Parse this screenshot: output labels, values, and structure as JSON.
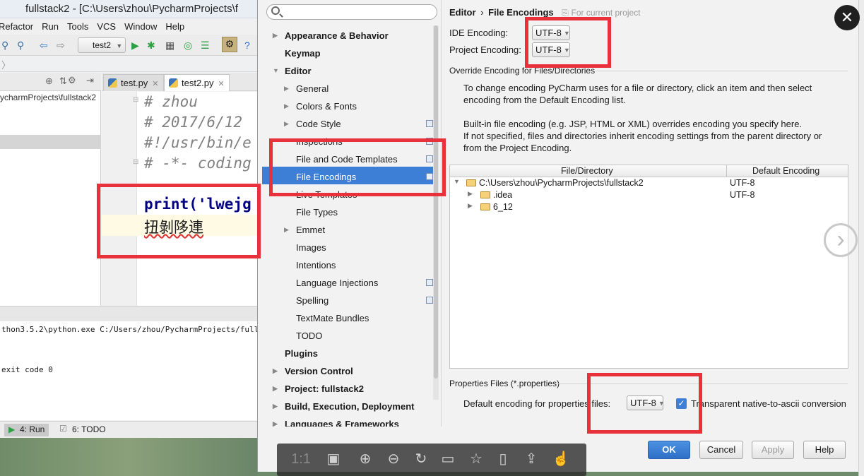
{
  "ide": {
    "title": "fullstack2 - [C:\\Users\\zhou\\PycharmProjects\\f",
    "menu": [
      "Refactor",
      "Run",
      "Tools",
      "VCS",
      "Window",
      "Help"
    ],
    "run_config": "test2",
    "project_path": "ycharmProjects\\fullstack2",
    "tabs": [
      {
        "label": "test.py",
        "active": false
      },
      {
        "label": "test2.py",
        "active": true
      }
    ],
    "code_lines": [
      {
        "text": "# zhou",
        "kind": "comment"
      },
      {
        "text": "# 2017/6/12",
        "kind": "comment"
      },
      {
        "text": "#!/usr/bin/e",
        "kind": "comment"
      },
      {
        "text": "# -*- coding",
        "kind": "comment"
      },
      {
        "text": "print('lwejg",
        "kind": "code"
      },
      {
        "text": "扭剝陊連",
        "kind": "garbled"
      }
    ],
    "console_lines": [
      "thon3.5.2\\python.exe C:/Users/zhou/PycharmProjects/fullstack2",
      "exit code 0"
    ],
    "bottom_tabs": [
      {
        "label": "4: Run",
        "active": true
      },
      {
        "label": "6: TODO",
        "active": false
      }
    ]
  },
  "dialog": {
    "search": {
      "placeholder": ""
    },
    "breadcrumb": {
      "section": "Editor",
      "separator": "›",
      "page": "File Encodings",
      "scope": "For current project"
    },
    "ide_encoding_label": "IDE Encoding:",
    "ide_encoding_value": "UTF-8",
    "project_encoding_label": "Project Encoding:",
    "project_encoding_value": "UTF-8",
    "override_title": "Override Encoding for Files/Directories",
    "help_text_1a": "To change encoding PyCharm uses for a file or directory, click an item and then select",
    "help_text_1b": "encoding from the Default Encoding list.",
    "help_text_2a": "Built-in file encoding (e.g. JSP, HTML or XML) overrides encoding you specify here.",
    "help_text_2b": "If not specified, files and directories inherit encoding settings from the parent directory or",
    "help_text_2c": "from the Project Encoding.",
    "table": {
      "columns": [
        "File/Directory",
        "Default Encoding"
      ],
      "rows": [
        {
          "path": "C:\\Users\\zhou\\PycharmProjects\\fullstack2",
          "encoding": "UTF-8"
        },
        {
          "path": ".idea",
          "encoding": "UTF-8"
        },
        {
          "path": "6_12",
          "encoding": ""
        }
      ]
    },
    "properties_title": "Properties Files (*.properties)",
    "properties_label": "Default encoding for properties files:",
    "properties_value": "UTF-8",
    "transparent_label": "Transparent native-to-ascii conversion",
    "transparent_checked": true,
    "buttons": {
      "ok": "OK",
      "cancel": "Cancel",
      "apply": "Apply",
      "help": "Help"
    }
  },
  "tree": [
    {
      "label": "Appearance & Behavior",
      "bold": true,
      "arrow": "right"
    },
    {
      "label": "Keymap",
      "bold": true,
      "arrow": ""
    },
    {
      "label": "Editor",
      "bold": true,
      "arrow": "down"
    },
    {
      "label": "General",
      "bold": false,
      "arrow": "right"
    },
    {
      "label": "Colors & Fonts",
      "bold": false,
      "arrow": "right"
    },
    {
      "label": "Code Style",
      "bold": false,
      "arrow": "right"
    },
    {
      "label": "Inspections",
      "bold": false,
      "arrow": ""
    },
    {
      "label": "File and Code Templates",
      "bold": false,
      "arrow": ""
    },
    {
      "label": "File Encodings",
      "bold": false,
      "arrow": "",
      "selected": true
    },
    {
      "label": "Live Templates",
      "bold": false,
      "arrow": ""
    },
    {
      "label": "File Types",
      "bold": false,
      "arrow": ""
    },
    {
      "label": "Emmet",
      "bold": false,
      "arrow": "right"
    },
    {
      "label": "Images",
      "bold": false,
      "arrow": ""
    },
    {
      "label": "Intentions",
      "bold": false,
      "arrow": ""
    },
    {
      "label": "Language Injections",
      "bold": false,
      "arrow": ""
    },
    {
      "label": "Spelling",
      "bold": false,
      "arrow": ""
    },
    {
      "label": "TextMate Bundles",
      "bold": false,
      "arrow": ""
    },
    {
      "label": "TODO",
      "bold": false,
      "arrow": ""
    },
    {
      "label": "Plugins",
      "bold": true,
      "arrow": ""
    },
    {
      "label": "Version Control",
      "bold": true,
      "arrow": "right"
    },
    {
      "label": "Project: fullstack2",
      "bold": true,
      "arrow": "right"
    },
    {
      "label": "Build, Execution, Deployment",
      "bold": true,
      "arrow": "right"
    },
    {
      "label": "Languages & Frameworks",
      "bold": true,
      "arrow": "right"
    }
  ],
  "viewer": {
    "zoom_label": "1:1",
    "icons": [
      "fit-screen-icon",
      "zoom-in-icon",
      "zoom-out-icon",
      "rotate-icon",
      "save-icon",
      "bookmark-icon",
      "phone-icon",
      "share-icon",
      "like-icon"
    ]
  },
  "colors": {
    "selection": "#3d7fd6",
    "annotation_red": "#e8313a",
    "ok_button": "#2f6fc7"
  }
}
